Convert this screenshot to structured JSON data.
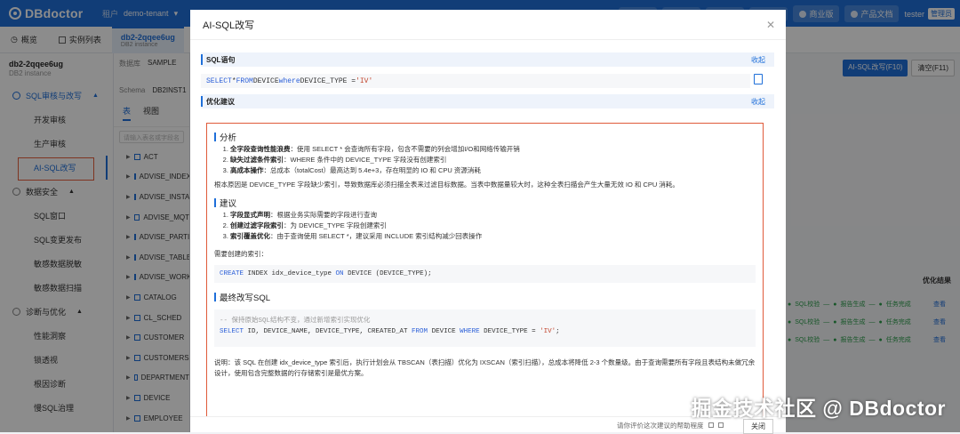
{
  "app": {
    "name": "DBdoctor",
    "tenant_label": "租户",
    "tenant_value": "demo-tenant"
  },
  "topbar": {
    "pill_1": "",
    "pill_2": "",
    "pill_3": "",
    "pill_4": "",
    "pro": "商业版",
    "docs": "产品文档",
    "user": "tester",
    "role": "管理员"
  },
  "tabs": {
    "overview": "概览",
    "instances": "实例列表",
    "db_name": "db2-2qqee6ug",
    "db_type": "DB2 instance"
  },
  "sidebar": {
    "instance_name": "db2-2qqee6ug",
    "instance_type": "DB2 instance",
    "groups": [
      {
        "label": "SQL审核与改写",
        "items": [
          "开发审核",
          "生产审核",
          "AI-SQL改写"
        ]
      },
      {
        "label": "数据安全",
        "items": [
          "SQL窗口",
          "SQL变更发布",
          "敏感数据脱敏",
          "敏感数据扫描"
        ]
      },
      {
        "label": "诊断与优化",
        "items": [
          "性能洞察",
          "锁透视",
          "根因诊断",
          "慢SQL治理"
        ]
      }
    ]
  },
  "tree": {
    "db_label": "数据库",
    "db_value": "SAMPLE",
    "schema_label": "Schema",
    "schema_value": "DB2INST1",
    "tab_table": "表",
    "tab_view": "视图",
    "search_placeholder": "请输入表名或字段名",
    "nodes": [
      "ACT",
      "ADVISE_INDEX",
      "ADVISE_INSTANCE",
      "ADVISE_MQT",
      "ADVISE_PARTITION",
      "ADVISE_TABLE",
      "ADVISE_WORKLOAD",
      "CATALOG",
      "CL_SCHED",
      "CUSTOMER",
      "CUSTOMERS",
      "DEPARTMENT",
      "DEVICE",
      "EMPLOYEE"
    ]
  },
  "background": {
    "btn_ai": "AI-SQL改写(F10)",
    "btn_clear": "清空(F11)",
    "col_result": "优化结果",
    "row_status": [
      "SQL校验",
      "报告生成",
      "任务完成"
    ],
    "view": "查看"
  },
  "modal": {
    "title": "AI-SQL改写",
    "sql_section": "SQL语句",
    "fold": "收起",
    "sql": {
      "kw1": "SELECT",
      "star": " * ",
      "kw2": "FROM",
      "tbl": " DEVICE ",
      "kw3": "where",
      "col": " DEVICE_TYPE = ",
      "val": "'IV'"
    },
    "advice_section": "优化建议",
    "analysis_title": "分析",
    "analysis": [
      {
        "b": "全字段查询性能浪费",
        "t": "：使用 SELECT * 会查询所有字段，包含不需要的列会增加I/O和网络传输开销"
      },
      {
        "b": "缺失过滤条件索引",
        "t": "：WHERE 条件中的 DEVICE_TYPE 字段没有创建索引"
      },
      {
        "b": "高成本操作",
        "t": "：总成本（totalCost）最高达到 5.4e+3，存在明显的 IO 和 CPU 资源消耗"
      }
    ],
    "root_cause": "根本原因是 DEVICE_TYPE 字段缺少索引，导致数据库必须扫描全表来过滤目标数据。当表中数据量较大时，这种全表扫描会产生大量无效 IO 和 CPU 消耗。",
    "suggest_title": "建议",
    "suggest": [
      {
        "b": "字段显式声明",
        "t": "：根据业务实际需要的字段进行查询"
      },
      {
        "b": "创建过滤字段索引",
        "t": "：为 DEVICE_TYPE 字段创建索引"
      },
      {
        "b": "索引覆盖优化",
        "t": "：由于查询使用 SELECT *，建议采用 INCLUDE 索引结构减少回表操作"
      }
    ],
    "need_index": "需要创建的索引：",
    "index_sql": {
      "kw1": "CREATE",
      "a": " INDEX idx_device_type ",
      "kw2": "ON",
      "b": " DEVICE (DEVICE_TYPE);"
    },
    "final_title": "最终改写SQL",
    "final_comment": "-- 保持原始SQL结构不变，通过新增索引实现优化",
    "final_sql": {
      "kw1": "SELECT",
      "a": " ID, DEVICE_NAME, DEVICE_TYPE, CREATED_AT ",
      "kw2": "FROM",
      "b": " DEVICE ",
      "kw3": "WHERE",
      "c": " DEVICE_TYPE = ",
      "val": "'IV'",
      "end": ";"
    },
    "explain": "说明：该 SQL 在创建 idx_device_type 索引后，执行计划会从 TBSCAN（表扫描）优化为 IXSCAN（索引扫描），总成本将降低 2-3 个数量级。由于查询需要所有字段且表结构未做冗余设计，使用包含完整数据的行存储索引是最优方案。",
    "rate": "请你评价这次建议的帮助程度",
    "close": "关闭"
  },
  "watermark": "掘金技术社区 @ DBdoctor"
}
